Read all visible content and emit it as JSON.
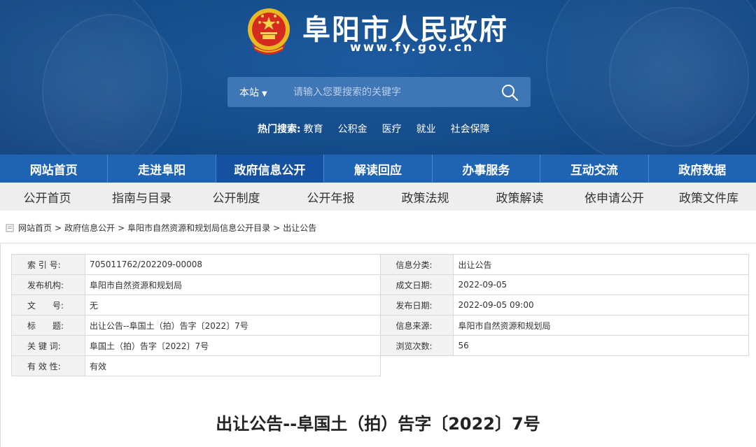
{
  "header": {
    "site_title": "阜阳市人民政府",
    "site_domain": "www.fy.gov.cn",
    "search": {
      "scope_label": "本站",
      "placeholder": "请输入您要搜索的关键字"
    },
    "hot_search": {
      "label": "热门搜索:",
      "items": [
        "教育",
        "公积金",
        "医疗",
        "就业",
        "社会保障"
      ]
    }
  },
  "main_nav": {
    "items": [
      "网站首页",
      "走进阜阳",
      "政府信息公开",
      "解读回应",
      "办事服务",
      "互动交流",
      "政府数据"
    ],
    "active_index": 2
  },
  "sub_nav": {
    "items": [
      "公开首页",
      "指南与目录",
      "公开制度",
      "公开年报",
      "政策法规",
      "政策解读",
      "依申请公开",
      "政策文件库"
    ]
  },
  "breadcrumb": {
    "items": [
      "网站首页",
      "政府信息公开",
      "阜阳市自然资源和规划局信息公开目录",
      "出让公告"
    ],
    "separator": ">"
  },
  "meta": {
    "index_no_label": "索 引 号:",
    "index_no": "705011762/202209-00008",
    "category_label": "信息分类:",
    "category": "出让公告",
    "publisher_label": "发布机构:",
    "publisher": "阜阳市自然资源和规划局",
    "created_label": "成文日期:",
    "created": "2022-09-05",
    "doc_no_label": "文　　号:",
    "doc_no": "无",
    "published_label": "发布日期:",
    "published": "2022-09-05 09:00",
    "title_label": "标　　题:",
    "title": "出让公告--阜国土（拍）告字〔2022〕7号",
    "source_label": "信息来源:",
    "source": "阜阳市自然资源和规划局",
    "keywords_label": "关 键 词:",
    "keywords": "阜国土（拍）告字〔2022〕7号",
    "views_label": "浏览次数:",
    "views": "56",
    "validity_label": "有 效 性:",
    "validity": "有效"
  },
  "article": {
    "title": "出让公告--阜国土（拍）告字〔2022〕7号"
  },
  "colors": {
    "banner_blue": "#17508f",
    "nav_blue": "#1f63b3",
    "nav_active": "#1451a0",
    "sub_nav_bg": "#eeeeee"
  }
}
